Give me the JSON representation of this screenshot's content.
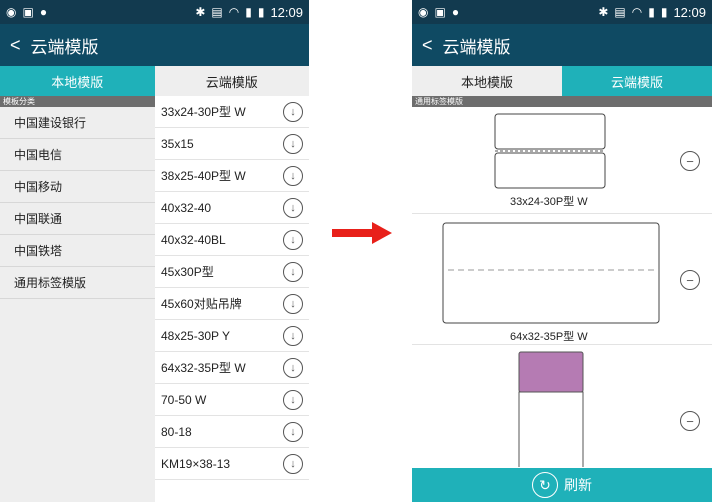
{
  "left": {
    "status_time": "12:09",
    "title": "云端模版",
    "tabs": [
      "本地模版",
      "云端模版"
    ],
    "category_header": "模板分类",
    "categories": [
      "中国建设银行",
      "中国电信",
      "中国移动",
      "中国联通",
      "中国铁塔",
      "通用标签模版"
    ],
    "templates": [
      "33x24-30P型 W",
      "35x15",
      "38x25-40P型 W",
      "40x32-40",
      "40x32-40BL",
      "45x30P型",
      "45x60对贴吊牌",
      "48x25-30P Y",
      "64x32-35P型 W",
      "70-50 W",
      "80-18",
      "KM19×38-13"
    ]
  },
  "right": {
    "status_time": "12:09",
    "title": "云端模版",
    "tabs": [
      "本地模版",
      "云端模版"
    ],
    "category_header": "通用标签模版",
    "templates": [
      "33x24-30P型 W",
      "64x32-35P型 W"
    ],
    "refresh_label": "刷新"
  },
  "colors": {
    "statusbar": "#123a4f",
    "appbar": "#0f4a63",
    "accent": "#1fb1b9",
    "arrow": "#e8201a",
    "label_swatch": "#b57bb3"
  }
}
